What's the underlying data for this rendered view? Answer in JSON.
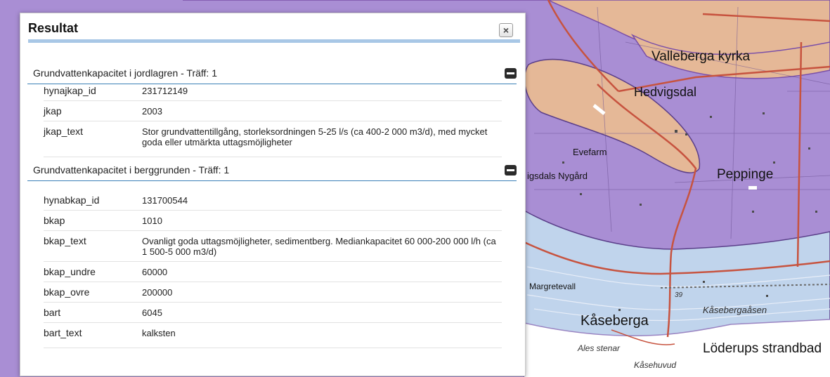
{
  "map": {
    "labels": {
      "valleberga": "Valleberga kyrka",
      "hedvigsdal": "Hedvigsdal",
      "evefarm": "Evefarm",
      "hedvigsdals_nygard": "igsdals Nygård",
      "peppinge": "Peppinge",
      "margretevall": "Margretevall",
      "kaseberga": "Kåseberga",
      "kasebergaasen": "Kåsebergaåsen",
      "ales_stenar": "Ales stenar",
      "kasehuvud": "Kåsehuvud",
      "loderups": "Löderups strandbad",
      "elevation": "39"
    },
    "colors": {
      "purple": "#a98ed4",
      "orange": "#e5b897",
      "blue": "#c0d4ec",
      "road": "#c7533f"
    }
  },
  "panel": {
    "title": "Resultat",
    "close_icon": "×",
    "sections": [
      {
        "title": "Grundvattenkapacitet i jordlagren - Träff: 1",
        "rows": [
          {
            "key": "hynajkap_id",
            "value": "231712149"
          },
          {
            "key": "jkap",
            "value": "2003"
          },
          {
            "key": "jkap_text",
            "value": "Stor grundvattentillgång, storleksordningen 5-25 l/s (ca 400-2 000 m3/d), med mycket goda eller utmärkta uttagsmöjligheter"
          }
        ]
      },
      {
        "title": "Grundvattenkapacitet i berggrunden - Träff: 1",
        "rows": [
          {
            "key": "hynabkap_id",
            "value": "131700544"
          },
          {
            "key": "bkap",
            "value": "1010"
          },
          {
            "key": "bkap_text",
            "value": "Ovanligt goda uttagsmöjligheter, sedimentberg. Mediankapacitet 60 000-200 000 l/h (ca 1 500-5 000 m3/d)"
          },
          {
            "key": "bkap_undre",
            "value": "60000"
          },
          {
            "key": "bkap_ovre",
            "value": "200000"
          },
          {
            "key": "bart",
            "value": "6045"
          },
          {
            "key": "bart_text",
            "value": "kalksten"
          }
        ]
      }
    ]
  }
}
